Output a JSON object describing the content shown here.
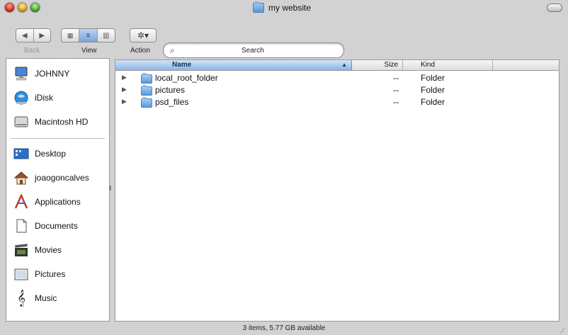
{
  "window": {
    "title": "my website"
  },
  "toolbar": {
    "back_label": "Back",
    "view_label": "View",
    "action_label": "Action",
    "search_label": "Search",
    "search_value": ""
  },
  "sidebar": {
    "devices": [
      {
        "label": "JOHNNY",
        "icon": "computer-icon"
      },
      {
        "label": "iDisk",
        "icon": "idisk-icon"
      },
      {
        "label": "Macintosh HD",
        "icon": "hard-drive-icon"
      }
    ],
    "places": [
      {
        "label": "Desktop",
        "icon": "desktop-icon"
      },
      {
        "label": "joaogoncalves",
        "icon": "home-icon"
      },
      {
        "label": "Applications",
        "icon": "applications-icon"
      },
      {
        "label": "Documents",
        "icon": "documents-icon"
      },
      {
        "label": "Movies",
        "icon": "movies-icon"
      },
      {
        "label": "Pictures",
        "icon": "pictures-icon"
      },
      {
        "label": "Music",
        "icon": "music-icon"
      }
    ]
  },
  "list": {
    "columns": {
      "name": "Name",
      "size": "Size",
      "kind": "Kind"
    },
    "rows": [
      {
        "name": "local_root_folder",
        "size": "--",
        "kind": "Folder"
      },
      {
        "name": "pictures",
        "size": "--",
        "kind": "Folder"
      },
      {
        "name": "psd_files",
        "size": "--",
        "kind": "Folder"
      }
    ]
  },
  "status": {
    "text": "3 items, 5.77 GB available"
  }
}
